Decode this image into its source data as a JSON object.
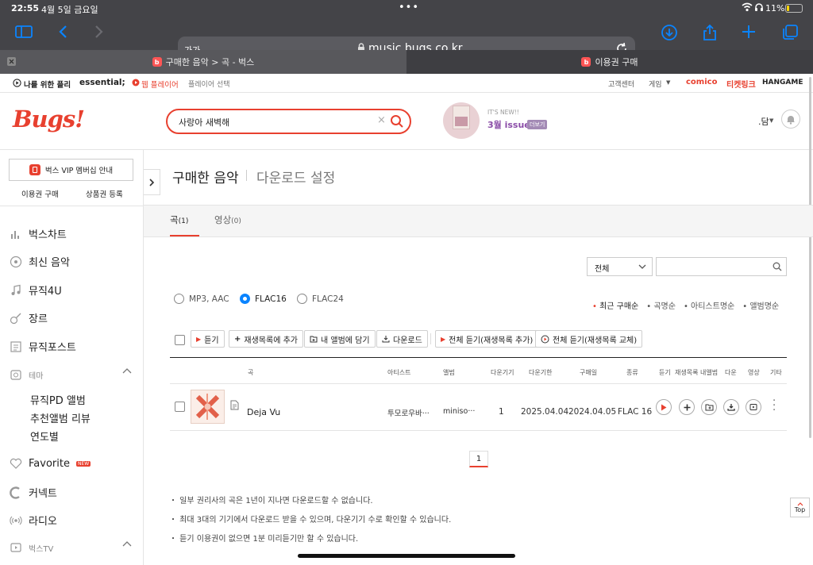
{
  "status": {
    "time": "22:55",
    "date": "4월 5일 금요일",
    "battery": "11%"
  },
  "browser": {
    "font_size_btn": "가가",
    "url": "music.bugs.co.kr"
  },
  "tabs": [
    {
      "label": "구매한 음악 > 곡 - 벅스"
    },
    {
      "label": "이용권 구매"
    }
  ],
  "gnb": {
    "left": [
      "나를 위한 플리",
      "essential;",
      "웹 플레이어",
      "플레이어 선택"
    ],
    "right": [
      "고객센터",
      "게임",
      "comico",
      "티켓링크",
      "HANGAME"
    ]
  },
  "header": {
    "logo": "Bugs!",
    "search_value": "사랑아 새벽해",
    "promo_small": "IT'S NEW!!",
    "promo_title": "3월 issue",
    "promo_btn": "더보기",
    "user": ".담"
  },
  "sidebar": {
    "vip": "벅스 VIP 멤버십 안내",
    "buy": "이용권 구매",
    "coupon": "상품권 등록",
    "items": [
      "벅스차트",
      "최신 음악",
      "뮤직4U",
      "장르",
      "뮤직포스트"
    ],
    "theme": "테마",
    "theme_sub": [
      "뮤직PD 앨범",
      "추천앨범 리뷰",
      "연도별"
    ],
    "items2": [
      "Favorite",
      "커넥트",
      "라디오"
    ],
    "new_badge": "NEW",
    "tv": "벅스TV"
  },
  "main": {
    "title": "구매한 음악",
    "title2": "다운로드 설정",
    "tab_song": "곡",
    "tab_song_count": "(1)",
    "tab_video": "영상",
    "tab_video_count": "(0)",
    "filter_select": "전체",
    "formats": [
      "MP3, AAC",
      "FLAC16",
      "FLAC24"
    ],
    "selected_format": "FLAC16",
    "sorts": [
      "최근 구매순",
      "곡명순",
      "아티스트명순",
      "앨범명순"
    ],
    "buttons": [
      "듣기",
      "재생목록에 추가",
      "내 앨범에 담기",
      "다운로드",
      "전체 듣기(재생목록 추가)",
      "전체 듣기(재생목록 교체)"
    ],
    "columns": [
      "곡",
      "아티스트",
      "앨범",
      "다운기기",
      "다운기한",
      "구매일",
      "종류",
      "듣기",
      "재생목록",
      "내앨범",
      "다운",
      "영상",
      "기타"
    ],
    "rows": [
      {
        "title": "Deja Vu",
        "artist": "투모로우바···",
        "album": "miniso···",
        "devices": "1",
        "deadline": "2025.04.04",
        "purchased": "2024.04.05",
        "kind": "FLAC 16"
      }
    ],
    "page": "1",
    "notes": [
      "・ 일부 권리사의 곡은 1년이 지나면 다운로드할 수 없습니다.",
      "・ 최대 3대의 기기에서 다운로드 받을 수 있으며, 다운기기 수로 확인할 수 있습니다.",
      "・ 듣기 이용권이 없으면 1분 미리듣기만 할 수 있습니다."
    ],
    "top": "Top"
  },
  "colors": {
    "accent": "#e8402f",
    "chrome": "#444448",
    "safari_blue": "#0a84ff"
  }
}
